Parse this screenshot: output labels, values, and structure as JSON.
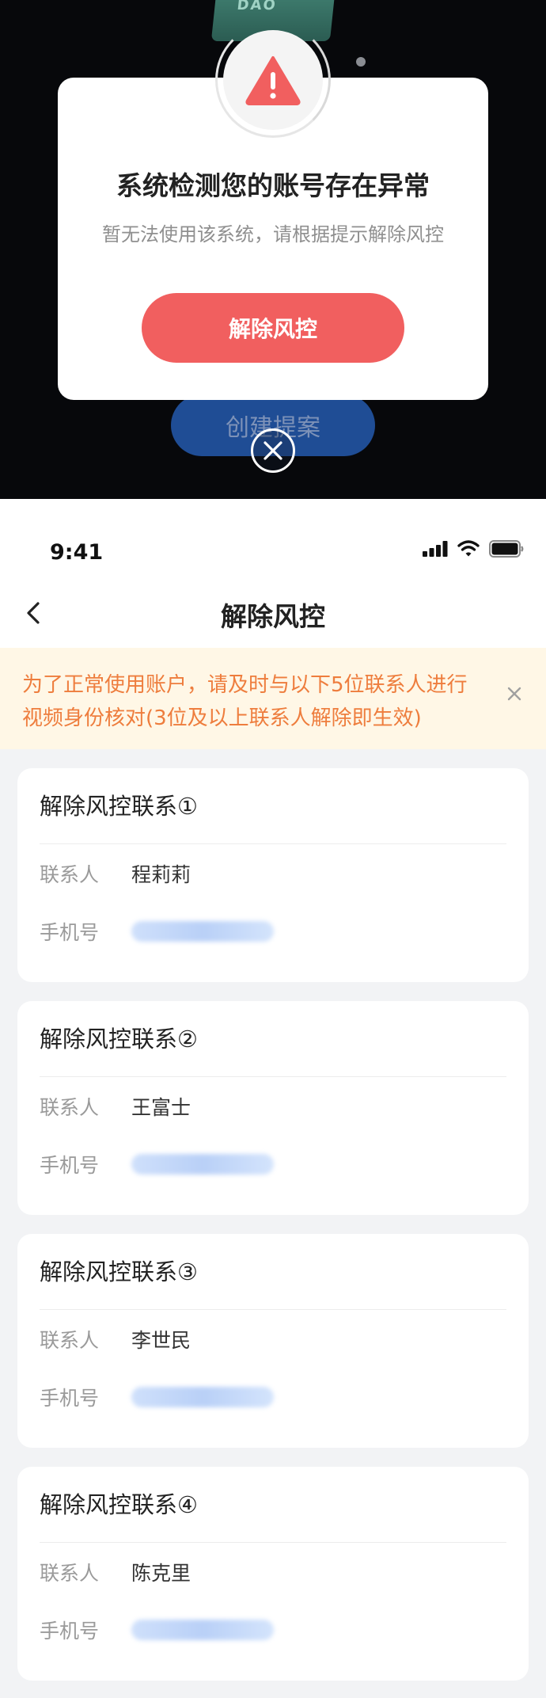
{
  "modal": {
    "title": "系统检测您的账号存在异常",
    "subtitle": "暂无法使用该系统，请根据提示解除风控",
    "button_label": "解除风控"
  },
  "background": {
    "box_text": "DAO",
    "behind_button_label": "创建提案"
  },
  "status_bar": {
    "time": "9:41"
  },
  "nav": {
    "title": "解除风控"
  },
  "notice": {
    "text": "为了正常使用账户，请及时与以下5位联系人进行视频身份核对(3位及以上联系人解除即生效)"
  },
  "contacts": [
    {
      "title": "解除风控联系①",
      "contact_label": "联系人",
      "name": "程莉莉",
      "phone_label": "手机号"
    },
    {
      "title": "解除风控联系②",
      "contact_label": "联系人",
      "name": "王富士",
      "phone_label": "手机号"
    },
    {
      "title": "解除风控联系③",
      "contact_label": "联系人",
      "name": "李世民",
      "phone_label": "手机号"
    },
    {
      "title": "解除风控联系④",
      "contact_label": "联系人",
      "name": "陈克里",
      "phone_label": "手机号"
    }
  ],
  "colors": {
    "accent_red": "#f15f5f",
    "notice_text": "#ee7d3d",
    "notice_bg": "#fff7e6",
    "primary_blue": "#1f4d95"
  }
}
